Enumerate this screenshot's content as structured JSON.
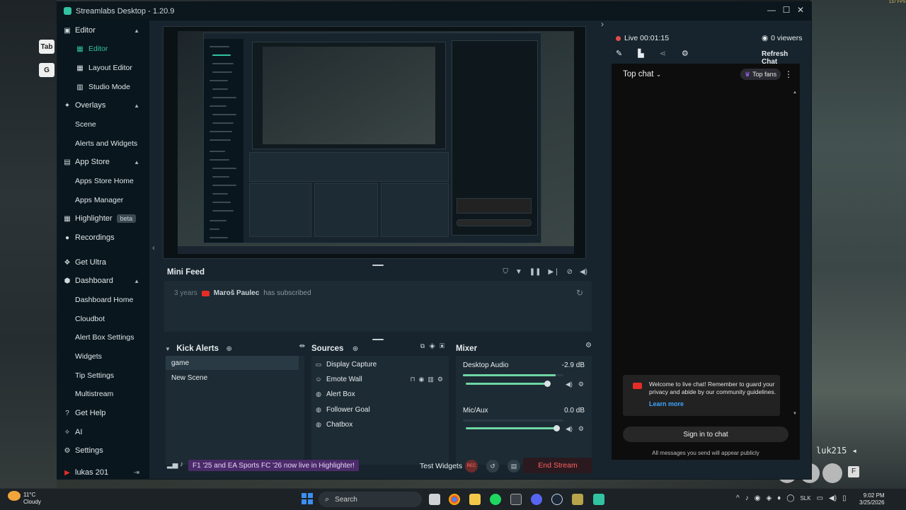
{
  "overlay": {
    "fps": "137 FPS",
    "key_tab": "Tab",
    "key_g": "G",
    "game_username": "luk215 ◂",
    "game_key_f": "F"
  },
  "window": {
    "title": "Streamlabs Desktop - 1.20.9",
    "controls": [
      "—",
      "☐",
      "✕"
    ]
  },
  "sidebar": {
    "editor": "Editor",
    "editor_sub": [
      "Editor",
      "Layout Editor",
      "Studio Mode"
    ],
    "overlays": "Overlays",
    "overlays_sub": [
      "Scene",
      "Alerts and Widgets"
    ],
    "app_store": "App Store",
    "app_store_sub": [
      "Apps Store Home",
      "Apps Manager"
    ],
    "highlighter": "Highlighter",
    "highlighter_badge": "beta",
    "recordings": "Recordings",
    "get_ultra": "Get Ultra",
    "dashboard": "Dashboard",
    "dashboard_sub": [
      "Dashboard Home",
      "Cloudbot",
      "Alert Box Settings",
      "Widgets",
      "Tip Settings",
      "Multistream"
    ],
    "get_help": "Get Help",
    "ai": "AI",
    "settings": "Settings",
    "user": "lukas 201"
  },
  "mini_feed": {
    "title": "Mini Feed",
    "event": {
      "time": "3 years",
      "name": "Maroš Paulec",
      "action": "has subscribed"
    }
  },
  "scenes": {
    "title": "Kick Alerts",
    "items": [
      "game",
      "New Scene"
    ],
    "selected": "game"
  },
  "sources": {
    "title": "Sources",
    "items": [
      "Display Capture",
      "Emote Wall",
      "Alert Box",
      "Follower Goal",
      "Chatbox"
    ]
  },
  "mixer": {
    "title": "Mixer",
    "channels": [
      {
        "name": "Desktop Audio",
        "db": "-2.9 dB",
        "meter": 0.92,
        "volume": 0.9
      },
      {
        "name": "Mic/Aux",
        "db": "0.0 dB",
        "meter": 0.0,
        "volume": 1.0
      }
    ]
  },
  "footer": {
    "highlighter_banner": "F1 '25 and EA Sports FC '26 now live in Highlighter!",
    "test_widgets": "Test Widgets",
    "rec_label": "REC",
    "end_stream": "End Stream"
  },
  "chat": {
    "live_time": "Live 00:01:15",
    "viewers": "0 viewers",
    "refresh": "Refresh Chat",
    "top_chat": "Top chat",
    "top_fans": "Top fans",
    "welcome": "Welcome to live chat! Remember to guard your privacy and abide by our community guidelines.",
    "learn_more": "Learn more",
    "sign_in": "Sign in to chat",
    "public_note": "All messages you send will appear publicly"
  },
  "taskbar": {
    "temp": "11°C",
    "condition": "Cloudy",
    "search": "Search",
    "lang": "SLK",
    "time": "9:02 PM",
    "date": "3/25/2026"
  },
  "colors": {
    "accent": "#31c3a2",
    "live": "#e84a4a",
    "meter": "#6fd6a6",
    "link": "#3ea6ff"
  }
}
